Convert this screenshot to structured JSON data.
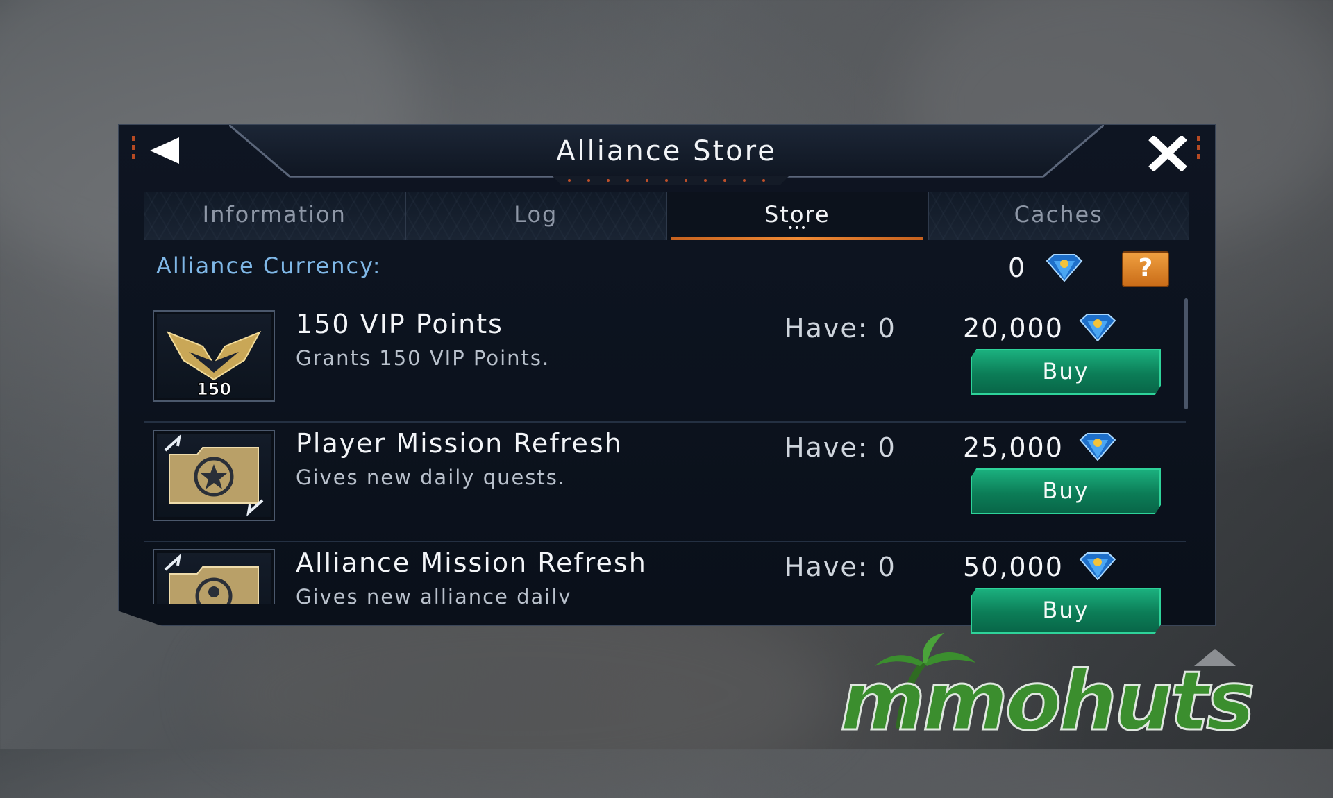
{
  "window": {
    "title": "Alliance Store"
  },
  "tabs": [
    {
      "label": "Information",
      "active": false
    },
    {
      "label": "Log",
      "active": false
    },
    {
      "label": "Store",
      "active": true
    },
    {
      "label": "Caches",
      "active": false
    }
  ],
  "currency": {
    "label": "Alliance Currency:",
    "value": "0",
    "icon": "diamond-gem-icon",
    "help_label": "?"
  },
  "items": [
    {
      "name": "150 VIP Points",
      "description": "Grants 150 VIP Points.",
      "have": "Have: 0",
      "price": "20,000",
      "buy_label": "Buy",
      "icon": "vip-wings-icon",
      "icon_badge": "150"
    },
    {
      "name": "Player Mission Refresh",
      "description": "Gives new daily quests.",
      "have": "Have: 0",
      "price": "25,000",
      "buy_label": "Buy",
      "icon": "mission-folder-star-icon"
    },
    {
      "name": "Alliance Mission Refresh",
      "description": "Gives new alliance daily",
      "have": "Have: 0",
      "price": "50,000",
      "buy_label": "Buy",
      "icon": "mission-folder-alliance-icon"
    }
  ],
  "watermark": {
    "text": "mmohuts"
  },
  "colors": {
    "accent_orange": "#f08a35",
    "buy_green": "#0c7d57",
    "currency_blue": "#7fb7e6",
    "gem_blue": "#2f8fe0"
  }
}
